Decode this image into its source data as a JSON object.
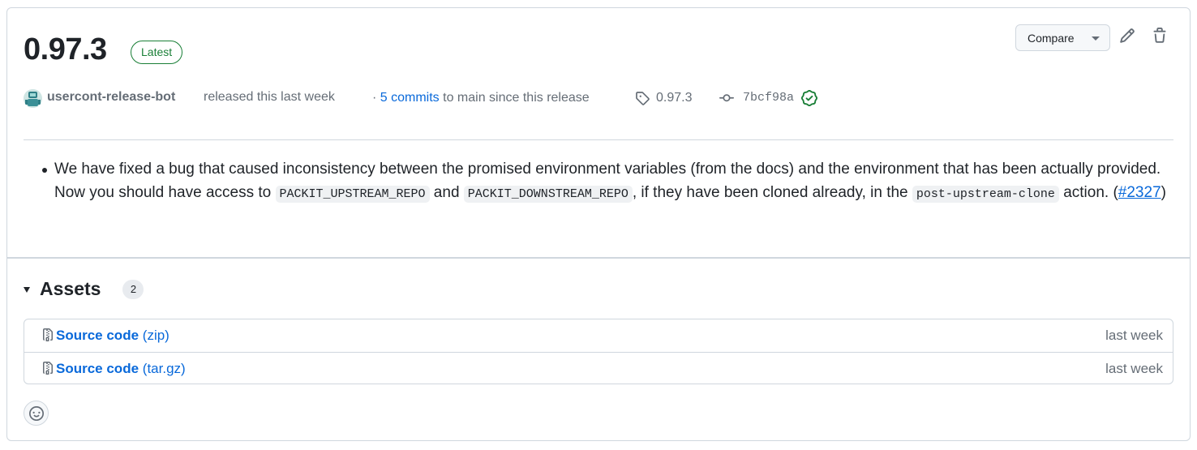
{
  "release": {
    "title": "0.97.3",
    "badge": "Latest",
    "compare_label": "Compare"
  },
  "meta": {
    "author": "usercont-release-bot",
    "released_text": "released this last week",
    "commits_prefix": "· ",
    "commits_link": "5 commits",
    "commits_suffix": " to main since this release",
    "tag": "0.97.3",
    "commit_sha": "7bcf98a"
  },
  "notes": {
    "item_part1": "We have fixed a bug that caused inconsistency between the promised environment variables (from the docs) and the environment that has been actually provided. Now you should have access to ",
    "code1": "PACKIT_UPSTREAM_REPO",
    "item_part2": " and ",
    "code2": "PACKIT_DOWNSTREAM_REPO",
    "item_part3": ", if they have been cloned already, in the ",
    "code3": "post-upstream-clone",
    "item_part4": " action. (",
    "issue_link": "#2327",
    "item_part5": ")"
  },
  "assets": {
    "title": "Assets",
    "count": "2",
    "items": [
      {
        "name": "Source code",
        "format": "(zip)",
        "date": "last week"
      },
      {
        "name": "Source code",
        "format": "(tar.gz)",
        "date": "last week"
      }
    ]
  },
  "colors": {
    "link": "#0969da",
    "latest_badge": "#1a7f37",
    "verified": "#1a7f37",
    "border": "#d0d7de",
    "muted_text": "#656d76"
  },
  "icons": {
    "edit": "pencil-icon",
    "delete": "trash-icon",
    "tag": "tag-icon",
    "commit": "git-commit-icon",
    "verified": "verified-check-icon",
    "asset": "file-zip-icon",
    "reaction": "smiley-icon"
  }
}
